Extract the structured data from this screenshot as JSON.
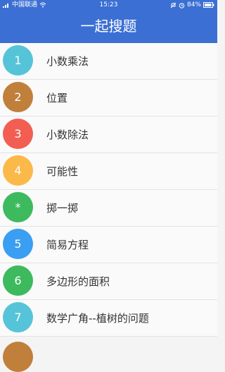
{
  "status_bar": {
    "carrier": "中国联通",
    "time": "15:23",
    "battery": "84%",
    "icons": [
      "signal-icon",
      "wifi-icon",
      "mute-icon",
      "alarm-icon",
      "battery-icon"
    ]
  },
  "app_bar": {
    "title": "一起搜题"
  },
  "list": [
    {
      "badge": "1",
      "label": "小数乘法",
      "color": "#56c4d8"
    },
    {
      "badge": "2",
      "label": "位置",
      "color": "#c17f3c"
    },
    {
      "badge": "3",
      "label": "小数除法",
      "color": "#f25f52"
    },
    {
      "badge": "4",
      "label": "可能性",
      "color": "#fbb94a"
    },
    {
      "badge": "*",
      "label": "掷一掷",
      "color": "#3dba5e"
    },
    {
      "badge": "5",
      "label": "简易方程",
      "color": "#3a9ef2"
    },
    {
      "badge": "6",
      "label": "多边形的面积",
      "color": "#3dba5e"
    },
    {
      "badge": "7",
      "label": "数学广角--植树的问题",
      "color": "#56c4d8"
    }
  ]
}
